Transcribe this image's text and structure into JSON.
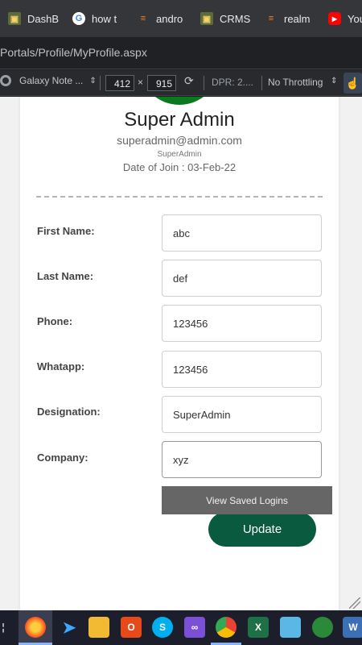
{
  "browser": {
    "tabs": [
      {
        "title": "DashB",
        "icon": "dashboard-favicon-icon"
      },
      {
        "title": "how t",
        "icon": "google-favicon-icon"
      },
      {
        "title": "andro",
        "icon": "stackoverflow-favicon-icon"
      },
      {
        "title": "CRMS",
        "icon": "dashboard-favicon-icon"
      },
      {
        "title": "realm",
        "icon": "stackoverflow-favicon-icon"
      },
      {
        "title": "You",
        "icon": "youtube-favicon-icon"
      }
    ],
    "url": "Portals/Profile/MyProfile.aspx"
  },
  "devtools": {
    "device": "Galaxy Note ...",
    "width": "412",
    "height": "915",
    "times": "×",
    "dpr": "DPR: 2....",
    "throttling": "No Throttling"
  },
  "profile": {
    "name": "Super Admin",
    "email": "superadmin@admin.com",
    "role": "SuperAdmin",
    "join": "Date of Join : 03-Feb-22"
  },
  "form": {
    "first_name": {
      "label": "First Name:",
      "value": "abc"
    },
    "last_name": {
      "label": "Last Name:",
      "value": "def"
    },
    "phone": {
      "label": "Phone:",
      "value": "123456"
    },
    "whatsapp": {
      "label": "Whatapp:",
      "value": "123456"
    },
    "designation": {
      "label": "Designation:",
      "value": "SuperAdmin"
    },
    "company": {
      "label": "Company:",
      "value": "xyz"
    },
    "autofill_popup": "View Saved Logins",
    "update_label": "Update"
  },
  "colors": {
    "accent": "#0a5a3f",
    "avatar": "#0b7a1e"
  }
}
